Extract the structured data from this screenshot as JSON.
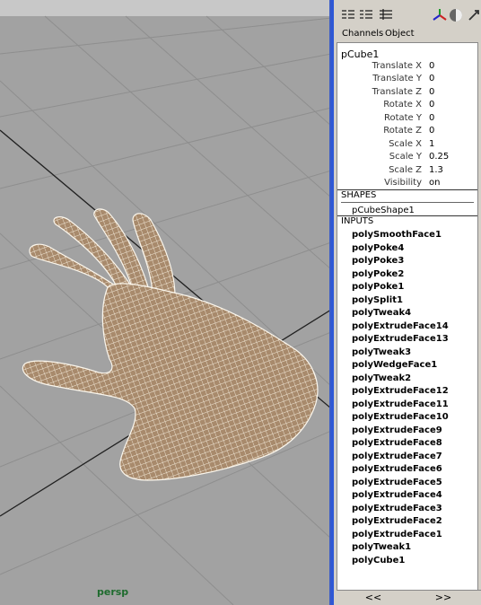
{
  "viewport": {
    "camera_label": "persp",
    "icons": [
      "polygon-hand-mesh",
      "grid-lines"
    ]
  },
  "panel": {
    "toolbar_icons": [
      "channel-box-icon",
      "layer-editor-icon",
      "attribute-editor-icon",
      "axis-icon",
      "render-icon",
      "pick-icon"
    ],
    "tabs": [
      "Channels",
      "Object"
    ],
    "node_name": "pCube1",
    "attributes": [
      {
        "label": "Translate X",
        "value": "0"
      },
      {
        "label": "Translate Y",
        "value": "0"
      },
      {
        "label": "Translate Z",
        "value": "0"
      },
      {
        "label": "Rotate X",
        "value": "0"
      },
      {
        "label": "Rotate Y",
        "value": "0"
      },
      {
        "label": "Rotate Z",
        "value": "0"
      },
      {
        "label": "Scale X",
        "value": "1"
      },
      {
        "label": "Scale Y",
        "value": "0.25"
      },
      {
        "label": "Scale Z",
        "value": "1.3"
      },
      {
        "label": "Visibility",
        "value": "on"
      }
    ],
    "shapes_header": "SHAPES",
    "shape_item": "pCubeShape1",
    "inputs_header": "INPUTS",
    "inputs": [
      "polySmoothFace1",
      "polyPoke4",
      "polyPoke3",
      "polyPoke2",
      "polyPoke1",
      "polySplit1",
      "polyTweak4",
      "polyExtrudeFace14",
      "polyExtrudeFace13",
      "polyTweak3",
      "polyWedgeFace1",
      "polyTweak2",
      "polyExtrudeFace12",
      "polyExtrudeFace11",
      "polyExtrudeFace10",
      "polyExtrudeFace9",
      "polyExtrudeFace8",
      "polyExtrudeFace7",
      "polyExtrudeFace6",
      "polyExtrudeFace5",
      "polyExtrudeFace4",
      "polyExtrudeFace3",
      "polyExtrudeFace2",
      "polyExtrudeFace1",
      "polyTweak1",
      "polyCube1"
    ],
    "nav_prev": "<<",
    "nav_next": ">>"
  },
  "colors": {
    "viewport_bg": "#a2a2a2",
    "mesh_fill": "#b89a7a",
    "mesh_wire": "#f0e8d8",
    "panel_border": "#2e58d6"
  }
}
